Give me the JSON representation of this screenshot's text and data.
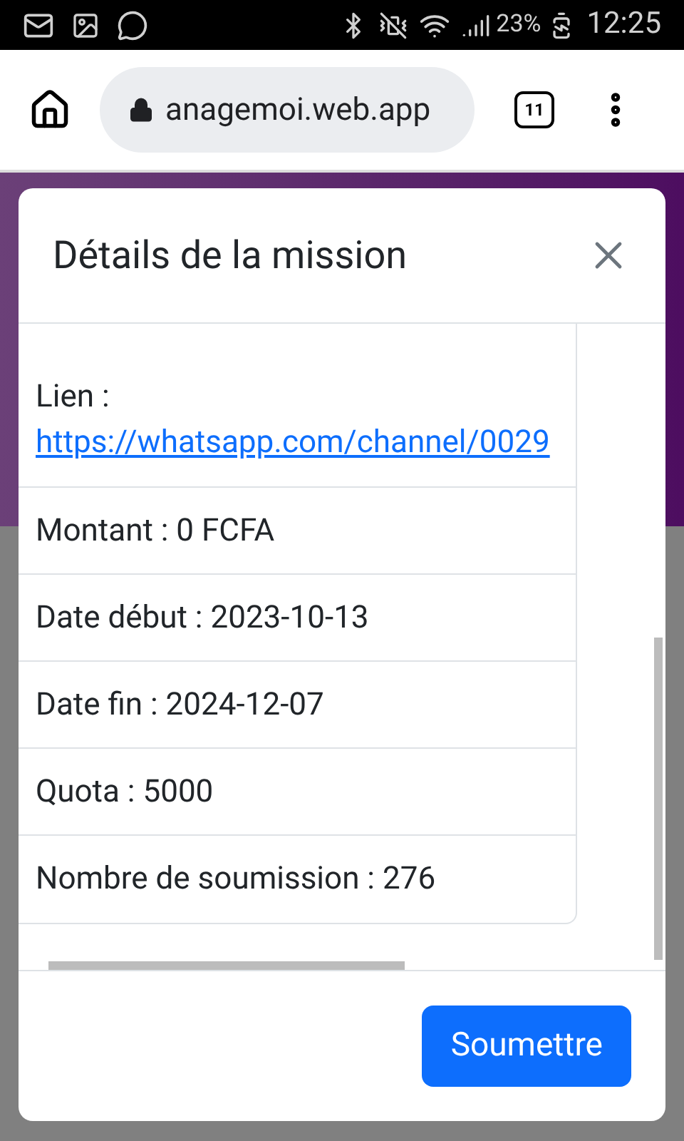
{
  "status_bar": {
    "battery": "23%",
    "time": "12:25"
  },
  "browser": {
    "url": "anagemoi.web.app",
    "tab_count": "11"
  },
  "modal": {
    "title": "Détails de la mission",
    "details": [
      {
        "kind": "link",
        "label": "Lien :",
        "url": "https://whatsapp.com/channel/0029"
      },
      {
        "kind": "text",
        "text": "Montant : 0 FCFA"
      },
      {
        "kind": "text",
        "text": "Date début : 2023-10-13"
      },
      {
        "kind": "text",
        "text": "Date fin : 2024-12-07"
      },
      {
        "kind": "text",
        "text": "Quota : 5000"
      },
      {
        "kind": "text",
        "text": "Nombre de soumission : 276"
      }
    ],
    "button": "Soumettre"
  }
}
